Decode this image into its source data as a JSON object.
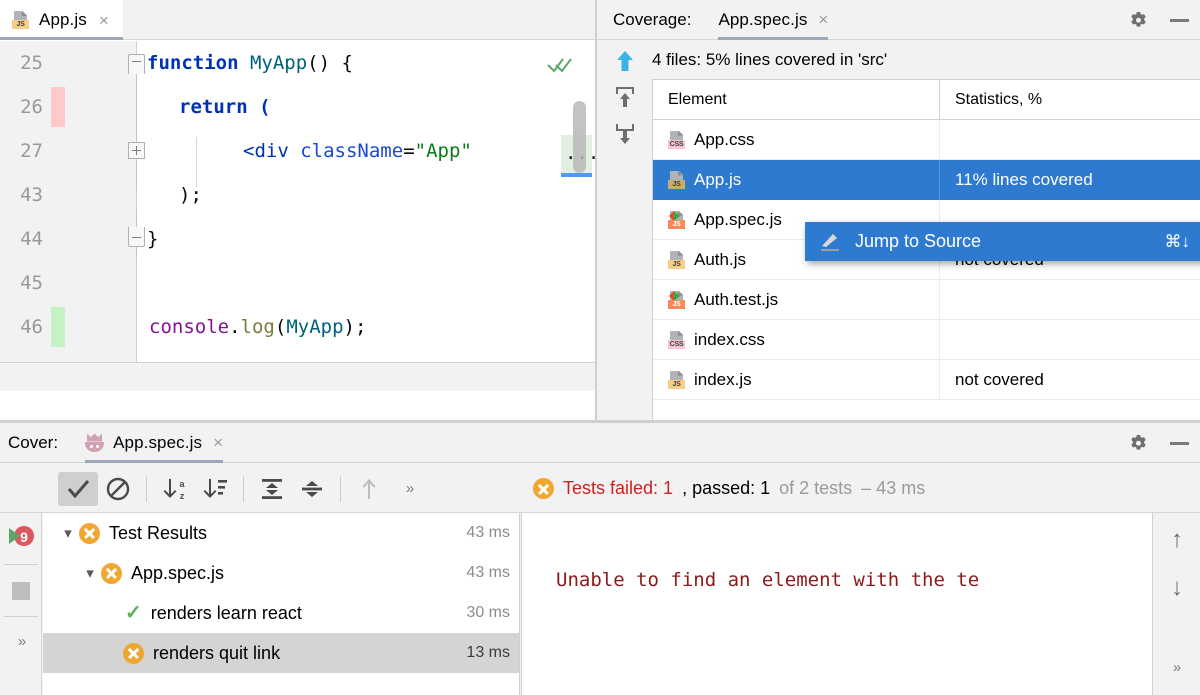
{
  "editor": {
    "tab": {
      "label": "App.js",
      "icon": "js-file-icon",
      "close": "×"
    },
    "lines": [
      {
        "num": "25",
        "coverage": "none"
      },
      {
        "num": "26",
        "coverage": "uncovered"
      },
      {
        "num": "27",
        "coverage": "none"
      },
      {
        "num": "43",
        "coverage": "none"
      },
      {
        "num": "44",
        "coverage": "none"
      },
      {
        "num": "45",
        "coverage": "none"
      },
      {
        "num": "46",
        "coverage": "covered"
      }
    ],
    "code": {
      "l25_kw": "function",
      "l25_fn": "MyApp",
      "l25_rest": "() {",
      "l26": "return (",
      "l27_open": "<",
      "l27_tag": "div",
      "l27_attr": "className",
      "l27_eq": "=",
      "l27_str": "\"App\"",
      "l43": ");",
      "l44": "}",
      "l46_obj": "console",
      "l46_dot": ".",
      "l46_prop": "log",
      "l46_open": "(",
      "l46_arg": "MyApp",
      "l46_close": ");"
    },
    "fold_ellipsis": "...",
    "inspection_status": "ok-double-check"
  },
  "coverage_panel": {
    "title": "Coverage:",
    "tab": {
      "label": "App.spec.js",
      "close": "×"
    },
    "summary": "4 files: 5% lines covered in 'src'",
    "actions": {
      "settings": "gear-icon",
      "minimize": "minimize-icon"
    },
    "left_tools": [
      "up-arrow-blue",
      "export-up-icon",
      "import-down-icon"
    ],
    "columns": [
      "Element",
      "Statistics, %"
    ],
    "rows": [
      {
        "name": "App.css",
        "stats": "",
        "icon": "css",
        "selected": false
      },
      {
        "name": "App.js",
        "stats": "11% lines covered",
        "icon": "js",
        "selected": true
      },
      {
        "name": "App.spec.js",
        "stats": "",
        "icon": "test",
        "selected": false
      },
      {
        "name": "Auth.js",
        "stats": "not covered",
        "icon": "js",
        "selected": false
      },
      {
        "name": "Auth.test.js",
        "stats": "",
        "icon": "test",
        "selected": false
      },
      {
        "name": "index.css",
        "stats": "",
        "icon": "css",
        "selected": false
      },
      {
        "name": "index.js",
        "stats": "not covered",
        "icon": "js",
        "selected": false
      }
    ],
    "context_menu": {
      "label": "Jump to Source",
      "shortcut": "⌘↓",
      "icon": "pencil-icon"
    }
  },
  "bottom_panel": {
    "title": "Cover:",
    "tab": {
      "label": "App.spec.js",
      "close": "×",
      "icon": "jest-icon"
    },
    "actions": {
      "settings": "gear-icon",
      "minimize": "minimize-icon"
    },
    "side_buttons": [
      "rerun-coverage-icon",
      "rerun-failed-icon",
      "stop-icon",
      "more-icon"
    ],
    "toolbar": [
      {
        "name": "show-passed",
        "icon": "check-icon",
        "active": true
      },
      {
        "name": "hide-ignored",
        "icon": "blocked-icon",
        "active": false
      },
      {
        "name": "sort-alphabetically",
        "icon": "sort-az-icon",
        "active": false
      },
      {
        "name": "sort-by-duration",
        "icon": "sort-duration-icon",
        "active": false
      },
      {
        "name": "expand-all",
        "icon": "expand-all-icon",
        "active": false
      },
      {
        "name": "collapse-all",
        "icon": "collapse-all-icon",
        "active": false
      },
      {
        "name": "previous-failed-test",
        "icon": "up-arrow-icon",
        "active": false
      },
      {
        "name": "more-actions",
        "icon": "chevron-double-right-icon",
        "active": false
      }
    ],
    "status": {
      "failed_label": "Tests failed: 1",
      "passed_label": ", passed: 1",
      "of_label": " of 2 tests ",
      "duration": "– 43 ms"
    },
    "tree": [
      {
        "label": "Test Results",
        "time": "43 ms",
        "status": "failed",
        "depth": 0,
        "expanded": true,
        "selected": false
      },
      {
        "label": "App.spec.js",
        "time": "43 ms",
        "status": "failed",
        "depth": 1,
        "expanded": true,
        "selected": false
      },
      {
        "label": "renders learn react",
        "time": "30 ms",
        "status": "passed",
        "depth": 2,
        "expanded": false,
        "selected": false
      },
      {
        "label": "renders quit link",
        "time": "13 ms",
        "status": "failed",
        "depth": 2,
        "expanded": false,
        "selected": true
      }
    ],
    "error_output": "Unable to find an element with the te",
    "error_nav": {
      "up": "↑",
      "down": "↓",
      "more": "»"
    }
  },
  "colors": {
    "selection_blue": "#2f7ad1",
    "fail_red": "#cc2121",
    "pass_green": "#59b259",
    "warn_orange": "#f0a732",
    "covered_green": "#c4f2c4",
    "uncovered_red": "#ffc9c9"
  }
}
